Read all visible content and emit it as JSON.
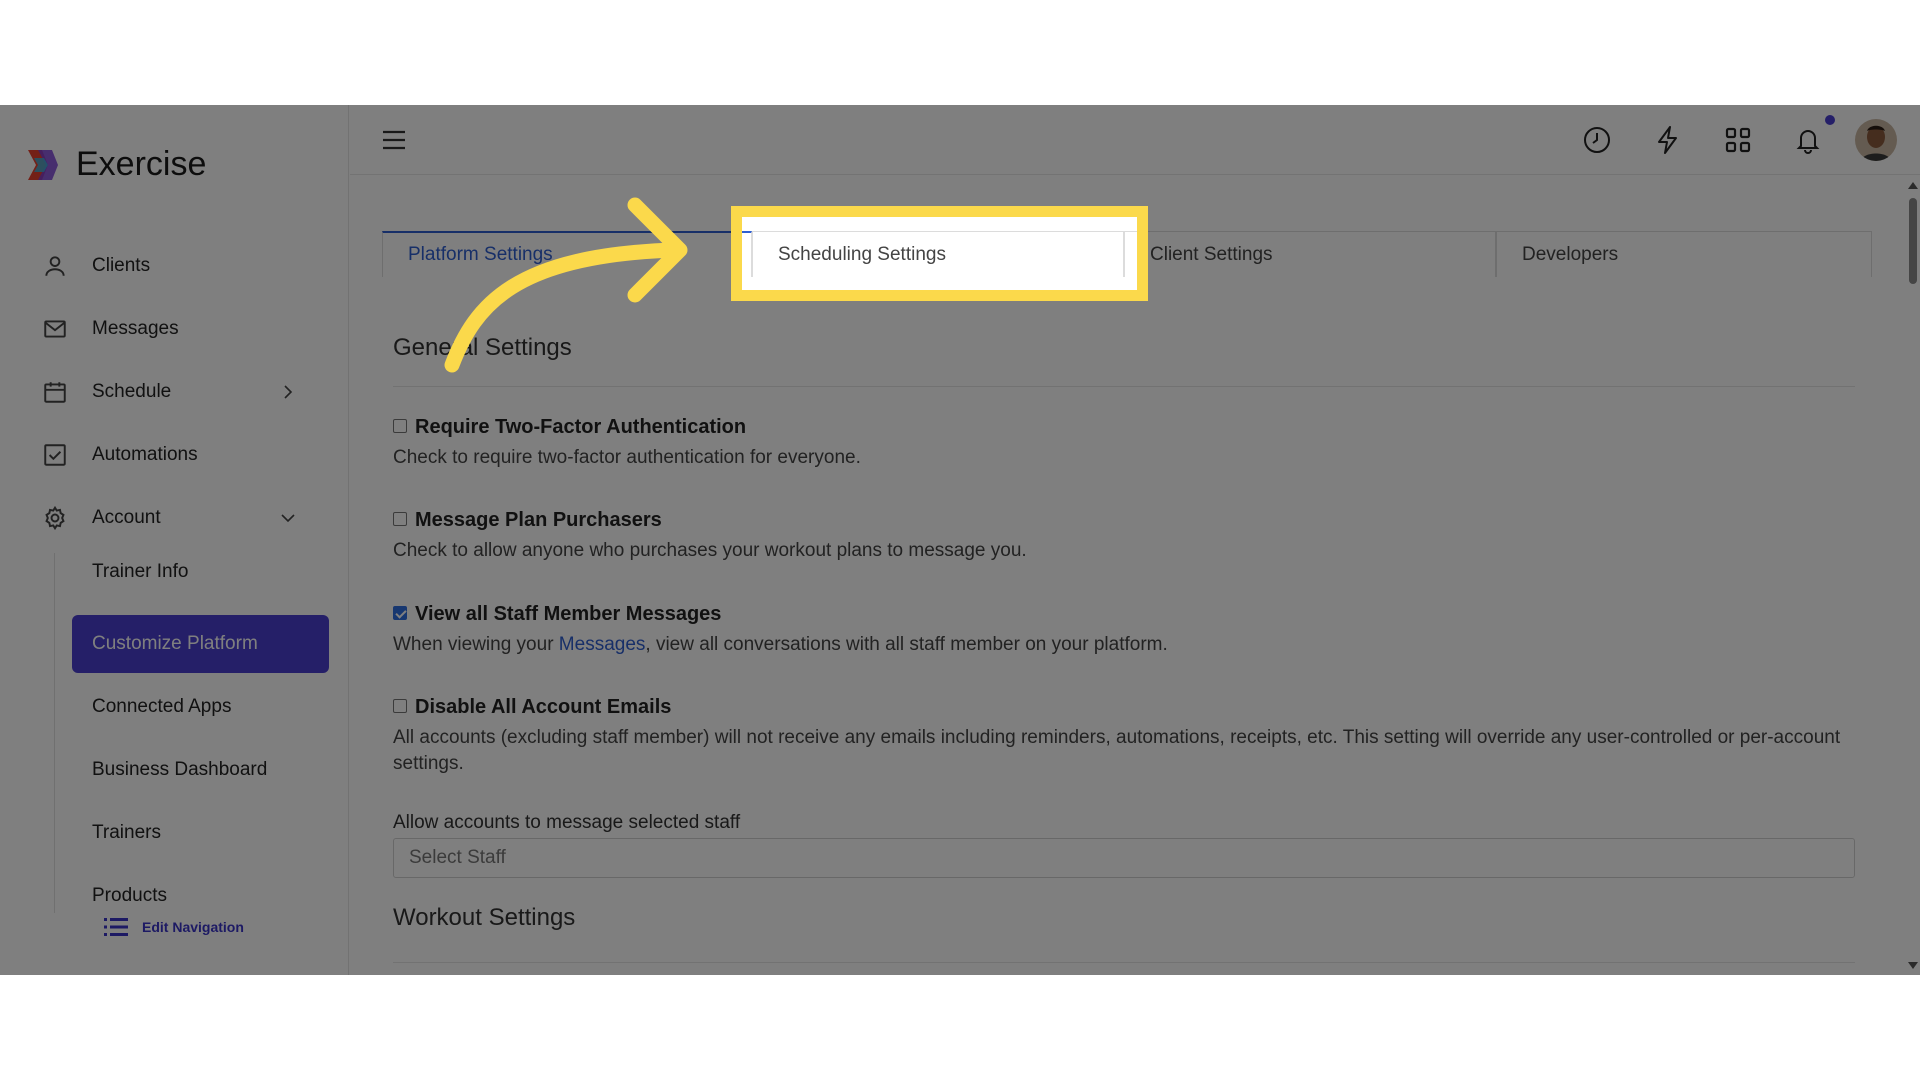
{
  "app": {
    "name": "Exercise"
  },
  "sidebar": {
    "items": [
      {
        "label": "Clients",
        "icon": "user-icon"
      },
      {
        "label": "Messages",
        "icon": "mail-icon"
      },
      {
        "label": "Schedule",
        "icon": "calendar-icon"
      },
      {
        "label": "Automations",
        "icon": "checkbox-icon"
      },
      {
        "label": "Account",
        "icon": "gear-icon"
      }
    ],
    "account_sub": [
      {
        "label": "Trainer Info"
      },
      {
        "label": "Customize Platform",
        "active": true
      },
      {
        "label": "Connected Apps"
      },
      {
        "label": "Business Dashboard"
      },
      {
        "label": "Trainers"
      },
      {
        "label": "Products"
      }
    ],
    "edit_nav": "Edit Navigation"
  },
  "tabs": [
    {
      "label": "Platform Settings",
      "active": true
    },
    {
      "label": "Scheduling Settings",
      "highlighted": true
    },
    {
      "label": "Client Settings"
    },
    {
      "label": "Developers"
    }
  ],
  "general": {
    "title": "General Settings",
    "settings": [
      {
        "label": "Require Two-Factor Authentication",
        "checked": false,
        "desc": "Check to require two-factor authentication for everyone."
      },
      {
        "label": "Message Plan Purchasers",
        "checked": false,
        "desc": "Check to allow anyone who purchases your workout plans to message you."
      },
      {
        "label": "View all Staff Member Messages",
        "checked": true,
        "desc_pre": "When viewing your ",
        "desc_link": "Messages",
        "desc_post": ", view all conversations with all staff member on your platform."
      },
      {
        "label": "Disable All Account Emails",
        "checked": false,
        "desc": "All accounts (excluding staff member) will not receive any emails including reminders, automations, receipts, etc. This setting will override any user-controlled or per-account settings."
      }
    ],
    "staff_label": "Allow accounts to message selected staff",
    "staff_placeholder": "Select Staff"
  },
  "workout": {
    "title": "Workout Settings"
  },
  "colors": {
    "accent": "#4a3fd1",
    "link": "#2f5fd1",
    "highlight": "#fbd94b",
    "overlay": "rgba(0,0,0,0.5)"
  }
}
